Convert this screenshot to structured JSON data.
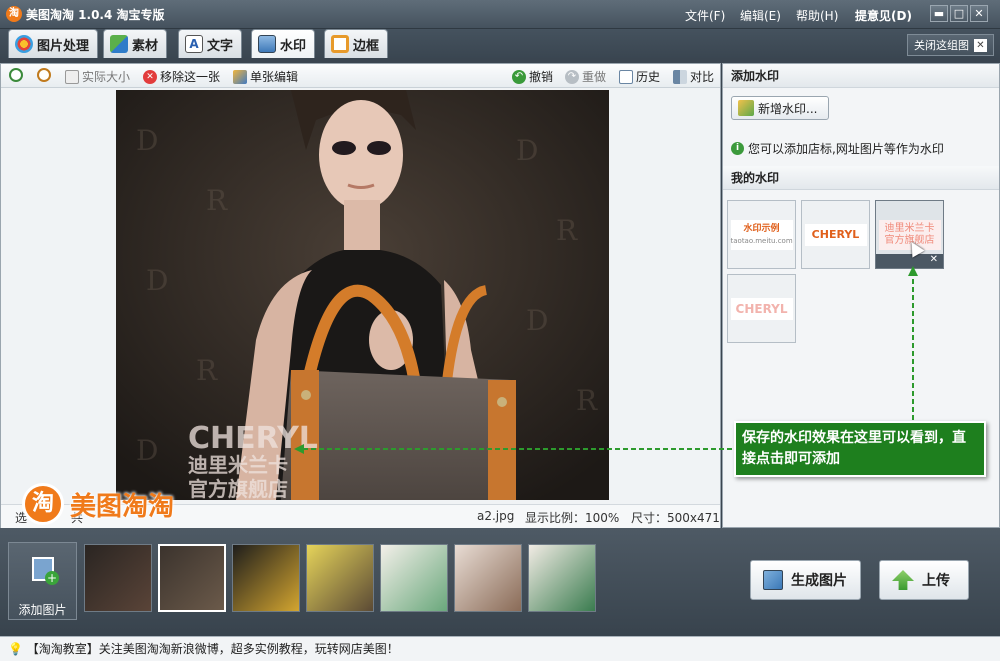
{
  "app": {
    "title": "美图淘淘 1.0.4 淘宝专版",
    "logo_char": "淘"
  },
  "menu": {
    "file": "文件(F)",
    "edit": "编辑(E)",
    "help": "帮助(H)",
    "feedback": "提意见(D)"
  },
  "window_buttons": {
    "restore_down": "▬",
    "minimize": "_",
    "maximize": "□",
    "close": "✕"
  },
  "tabs": [
    {
      "label": "图片处理"
    },
    {
      "label": "素材"
    },
    {
      "label": "文字"
    },
    {
      "label": "水印"
    },
    {
      "label": "边框"
    }
  ],
  "close_group_label": "关闭这组图",
  "toolbar": {
    "actual_size": "实际大小",
    "remove_one": "移除这一张",
    "single_edit": "单张编辑",
    "undo": "撤销",
    "redo": "重做",
    "history": "历史",
    "compare": "对比"
  },
  "canvas": {
    "watermark_line1": "CHERYL",
    "watermark_line2": "迪里米兰卡",
    "watermark_line3": "官方旗舰店"
  },
  "status": {
    "left_fragment_a": "选",
    "left_fragment_b": "共",
    "filename": "a2.jpg",
    "ratio": "显示比例：100%",
    "size": "尺寸：500x471"
  },
  "overlay_logo": {
    "char": "淘",
    "text": "美图淘淘"
  },
  "right_panel": {
    "add_header": "添加水印",
    "add_button": "新增水印...",
    "hint": "您可以添加店标,网址图片等作为水印",
    "my_header": "我的水印",
    "items": [
      {
        "line1": "水印示例",
        "line2": "taotao.meitu.com"
      },
      {
        "line1": "CHERYL"
      },
      {
        "line1": "迪里米兰卡",
        "line2": "官方旗舰店"
      },
      {
        "line1": "CHERYL"
      }
    ],
    "delete_glyph": "✕"
  },
  "callout": {
    "text": "保存的水印效果在这里可以看到，直接点击即可添加"
  },
  "bottom": {
    "add_photo": "添加图片",
    "generate": "生成图片",
    "upload": "上传"
  },
  "footer": {
    "text": "【淘淘教室】关注美图淘淘新浪微博，超多实例教程，玩转网店美图！"
  },
  "colors": {
    "accent_orange": "#f07a1a",
    "callout_green": "#1e7f1e",
    "panel_bg": "#f3f5f7"
  }
}
